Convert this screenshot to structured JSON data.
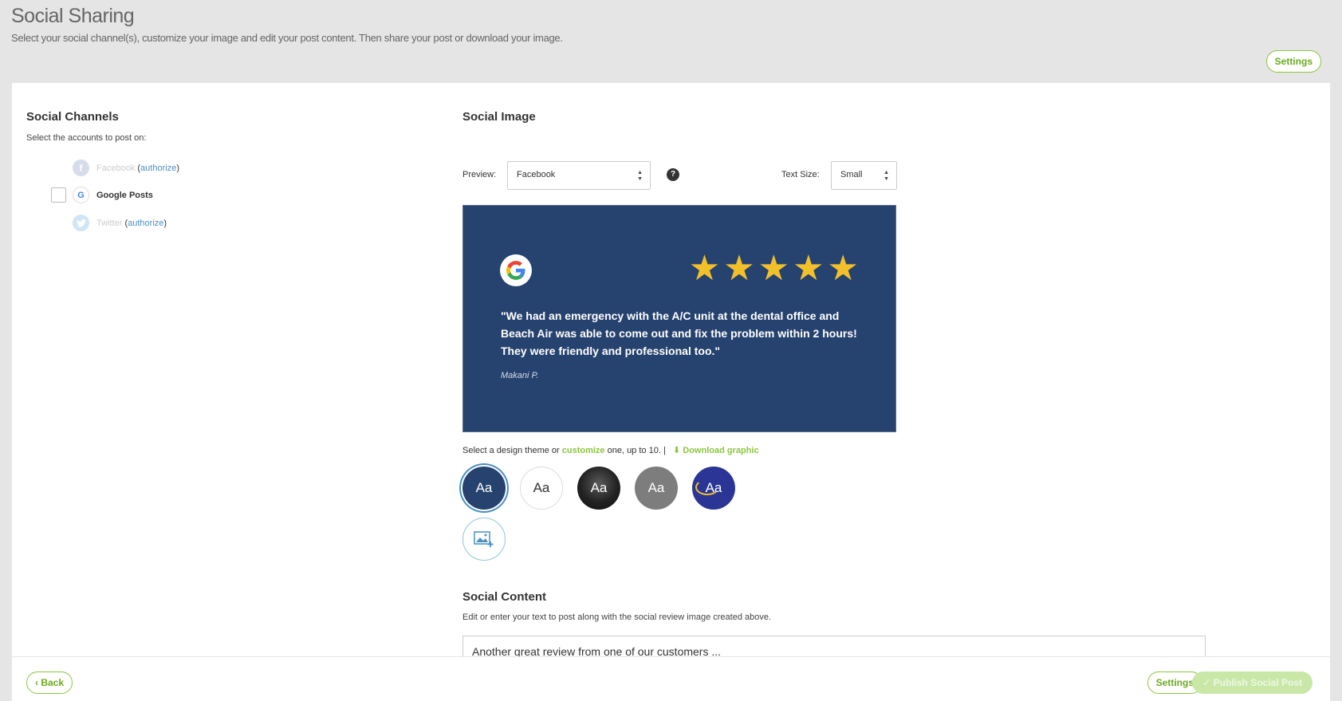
{
  "header": {
    "title": "Social Sharing",
    "subtitle": "Select your social channel(s), customize your image and edit your post content. Then share your post or download your image.",
    "settings_label": "Settings"
  },
  "channels": {
    "title": "Social Channels",
    "subtitle": "Select the accounts to post on:",
    "authorize_label": "authorize",
    "items": [
      {
        "name": "Facebook",
        "icon": "facebook-icon"
      },
      {
        "name": "Google Posts",
        "icon": "google-icon"
      },
      {
        "name": "Twitter",
        "icon": "twitter-icon"
      }
    ]
  },
  "social_image": {
    "title": "Social Image",
    "preview_label": "Preview:",
    "preview_value": "Facebook",
    "help_glyph": "?",
    "text_size_label": "Text Size:",
    "text_size_value": "Small",
    "card": {
      "quote": "\"We had an emergency with the A/C unit at the dental office and Beach Air was able to come out and fix the problem within 2 hours! They were friendly and professional too.\"",
      "author": "Makani P.",
      "stars": 5,
      "star_glyph": "★",
      "background_color": "#26426f",
      "star_color": "#f2c02b"
    },
    "theme_text_before": "Select a design theme or ",
    "theme_customize": "customize",
    "theme_text_after": " one, up to 10.  |",
    "download_label": "Download graphic",
    "theme_glyph": "Aa"
  },
  "social_content": {
    "title": "Social Content",
    "subtitle": "Edit or enter your text to post along with the social review image created above.",
    "text": "Another great review from one of our customers ..."
  },
  "footer": {
    "back_label": "‹ Back",
    "settings_label": "Settings",
    "publish_label": "✓ Publish Social Post"
  },
  "colors": {
    "accent_green": "#8cc63f",
    "link_blue": "#4a90c2"
  }
}
